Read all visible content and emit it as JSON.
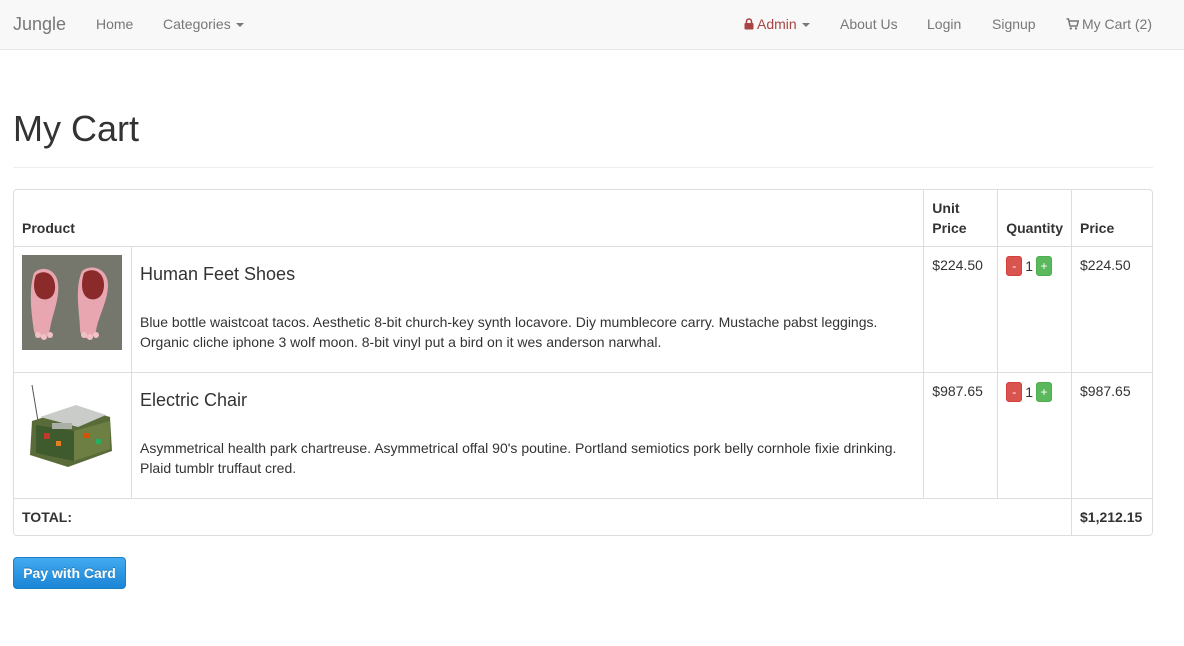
{
  "nav": {
    "brand": "Jungle",
    "home": "Home",
    "categories": "Categories",
    "admin": "Admin",
    "about": "About Us",
    "login": "Login",
    "signup": "Signup",
    "cart": "My Cart (2)"
  },
  "page_title": "My Cart",
  "table": {
    "headers": {
      "product": "Product",
      "unit_price_1": "Unit",
      "unit_price_2": "Price",
      "quantity": "Quantity",
      "price": "Price"
    },
    "items": [
      {
        "name": "Human Feet Shoes",
        "description": "Blue bottle waistcoat tacos. Aesthetic 8-bit church-key synth locavore. Diy mumblecore carry. Mustache pabst leggings. Organic cliche iphone 3 wolf moon. 8-bit vinyl put a bird on it wes anderson narwhal.",
        "unit_price": "$224.50",
        "quantity": "1",
        "price": "$224.50",
        "minus": "-",
        "plus": "+"
      },
      {
        "name": "Electric Chair",
        "description": "Asymmetrical health park chartreuse. Asymmetrical offal 90's poutine. Portland semiotics pork belly cornhole fixie drinking. Plaid tumblr truffaut cred.",
        "unit_price": "$987.65",
        "quantity": "1",
        "price": "$987.65",
        "minus": "-",
        "plus": "+"
      }
    ],
    "total_label": "TOTAL:",
    "total_value": "$1,212.15"
  },
  "pay_button": "Pay with Card",
  "colors": {
    "accent": "#1b85d6",
    "minus": "#d9534f",
    "plus": "#5cb85c",
    "admin": "#a94442"
  }
}
